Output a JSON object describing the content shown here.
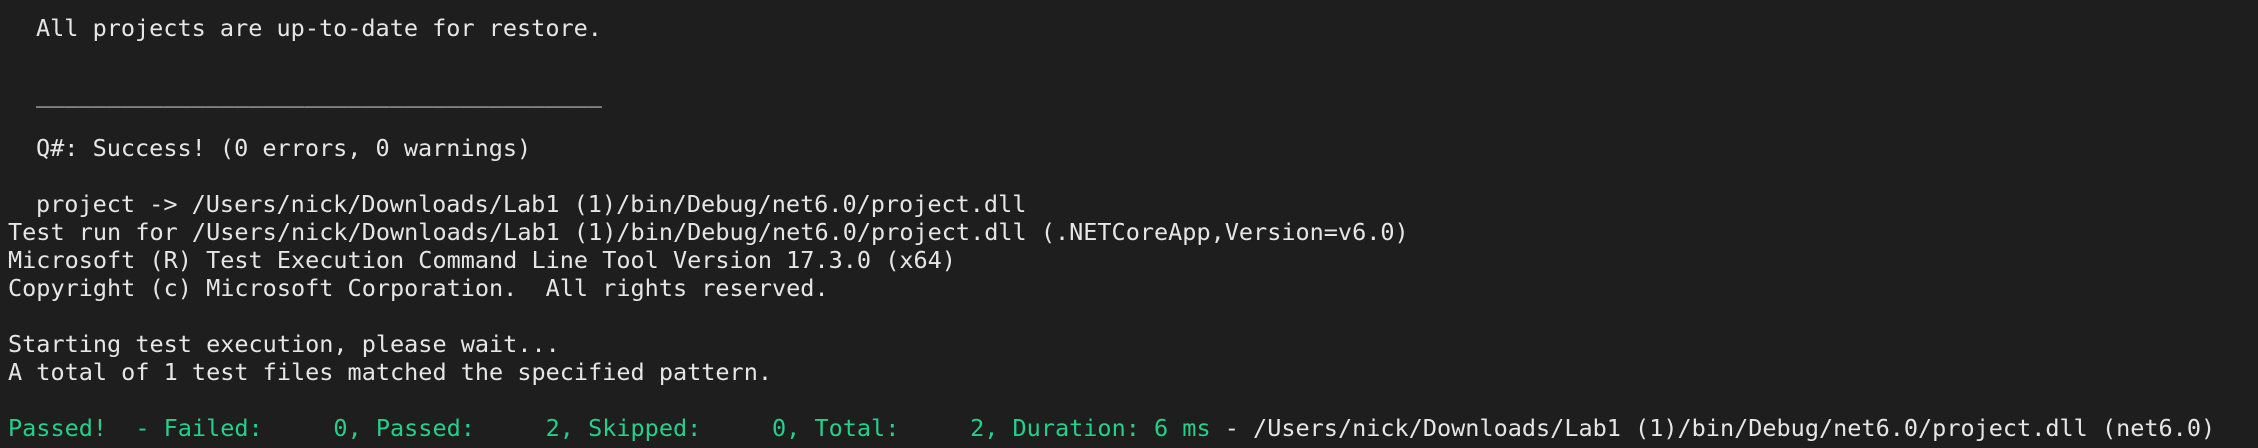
{
  "terminal": {
    "restore_msg": "All projects are up-to-date for restore.",
    "separator": "________________________________________",
    "qsharp_status": "Q#: Success! (0 errors, 0 warnings)",
    "build_output": "project -> /Users/nick/Downloads/Lab1 (1)/bin/Debug/net6.0/project.dll",
    "test_run_for": "Test run for /Users/nick/Downloads/Lab1 (1)/bin/Debug/net6.0/project.dll (.NETCoreApp,Version=v6.0)",
    "tool_version": "Microsoft (R) Test Execution Command Line Tool Version 17.3.0 (x64)",
    "copyright": "Copyright (c) Microsoft Corporation.  All rights reserved.",
    "starting": "Starting test execution, please wait...",
    "matched": "A total of 1 test files matched the specified pattern.",
    "summary": {
      "result": "Passed!",
      "counts": "  - Failed:     0, Passed:     2, Skipped:     0, Total:     2, Duration: 6 ms",
      "target": " - /Users/nick/Downloads/Lab1 (1)/bin/Debug/net6.0/project.dll (net6.0)"
    }
  },
  "colors": {
    "background": "#1e1e1e",
    "text": "#e6e6e6",
    "success": "#23d18b"
  }
}
